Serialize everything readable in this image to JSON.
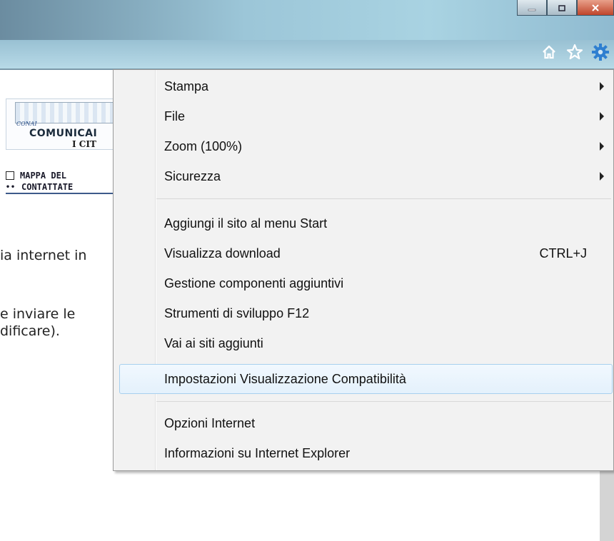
{
  "window": {
    "buttons": [
      "minimize",
      "restore",
      "close"
    ]
  },
  "toolbar": {
    "icons": [
      "home-icon",
      "star-icon",
      "gear-icon"
    ]
  },
  "page": {
    "banner_line1": "COMUNICAI",
    "banner_line2": "I CIT",
    "banner_brand": "CONAI",
    "link1": "MAPPA DEL",
    "link2": "CONTATTATE",
    "text1": "ia internet in",
    "text2": "e inviare le",
    "text3": "dificare)."
  },
  "menu": {
    "items": [
      {
        "label": "Stampa",
        "submenu": true
      },
      {
        "label": "File",
        "submenu": true
      },
      {
        "label": "Zoom (100%)",
        "submenu": true
      },
      {
        "label": "Sicurezza",
        "submenu": true
      },
      {
        "label": "Aggiungi il sito al menu Start"
      },
      {
        "label": "Visualizza download",
        "shortcut": "CTRL+J"
      },
      {
        "label": "Gestione componenti aggiuntivi"
      },
      {
        "label": "Strumenti di sviluppo F12"
      },
      {
        "label": "Vai ai siti aggiunti"
      },
      {
        "label": "Impostazioni Visualizzazione Compatibilità",
        "highlighted": true
      },
      {
        "label": "Opzioni Internet"
      },
      {
        "label": "Informazioni su Internet Explorer"
      }
    ]
  },
  "colors": {
    "highlight_border": "#a8d0ee",
    "highlight_bg": "#e4f1fc",
    "menu_bg": "#f2f2f2",
    "gear": "#2f7fd0"
  }
}
